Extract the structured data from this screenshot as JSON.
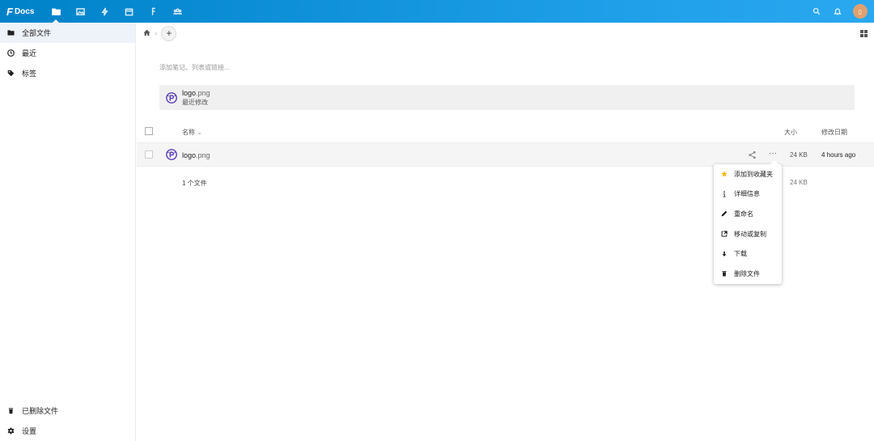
{
  "brand": {
    "f": "F",
    "name": "Docs"
  },
  "header": {
    "apps": [
      {
        "name": "files-app-icon",
        "active": true
      },
      {
        "name": "photos-app-icon",
        "active": false
      },
      {
        "name": "activity-app-icon",
        "active": false
      },
      {
        "name": "calendar-app-icon",
        "active": false
      },
      {
        "name": "f-app-icon",
        "active": false
      },
      {
        "name": "contacts-app-icon",
        "active": false
      }
    ],
    "right_icons": [
      "search-icon",
      "notifications-icon"
    ],
    "avatar_initial": "▯",
    "avatar_color": "#e0a070"
  },
  "sidebar": {
    "items": [
      {
        "label": "全部文件",
        "icon": "folder-icon"
      },
      {
        "label": "最近",
        "icon": "clock-icon"
      },
      {
        "label": "标签",
        "icon": "tag-icon"
      }
    ],
    "bottom": [
      {
        "label": "已删除文件",
        "icon": "trash-icon"
      },
      {
        "label": "设置",
        "icon": "gear-icon"
      }
    ]
  },
  "main": {
    "add_button": "+",
    "rich_workspace_placeholder": "添加笔记、列表或链接...",
    "recent": {
      "name": "logo",
      "ext": ".png",
      "subtitle": "最近修改"
    },
    "columns": {
      "name": "名称",
      "sort_indicator": "⌄",
      "size": "大小",
      "modified": "修改日期"
    },
    "files": [
      {
        "name": "logo",
        "ext": ".png",
        "more": "···",
        "size": "24 KB",
        "modified": "4 hours ago"
      }
    ],
    "summary": {
      "count": "1 个文件",
      "size": "24 KB"
    }
  },
  "menu": {
    "items": [
      {
        "label": "添加到收藏夹",
        "icon": "star-icon"
      },
      {
        "label": "详细信息",
        "icon": "info-icon"
      },
      {
        "label": "重命名",
        "icon": "pencil-icon"
      },
      {
        "label": "移动或复制",
        "icon": "external-link-icon"
      },
      {
        "label": "下载",
        "icon": "download-icon"
      },
      {
        "label": "删除文件",
        "icon": "trash-icon"
      }
    ]
  },
  "colors": {
    "header": "#0082c9",
    "star": "#f5b70a",
    "file_icon": "#5b3fb5"
  }
}
